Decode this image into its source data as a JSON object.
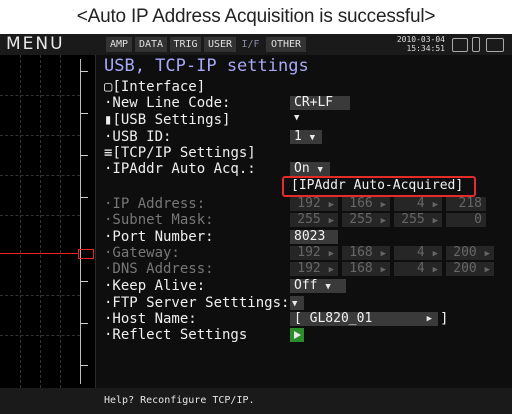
{
  "caption": "<Auto IP Address Acquisition is successful>",
  "topbar": {
    "menu": "MENU",
    "tabs": [
      {
        "label": "AMP"
      },
      {
        "label": "DATA"
      },
      {
        "label": "TRIG"
      },
      {
        "label": "USER"
      },
      {
        "label": "I/F"
      },
      {
        "label": "OTHER"
      }
    ],
    "date": "2010-03-04",
    "time": "15:34:51"
  },
  "settings": {
    "title": "USB, TCP-IP settings",
    "interface_header": "[Interface]",
    "new_line_code": {
      "label": "·New Line Code:",
      "value": "CR+LF"
    },
    "usb_header": "[USB Settings]",
    "usb_id": {
      "label": "·USB ID:",
      "value": "1"
    },
    "tcpip_header": "[TCP/IP Settings]",
    "ipaddr_auto": {
      "label": "·IPAddr Auto Acq.:",
      "value": "On"
    },
    "auto_acquired_note": "[IPAddr Auto-Acquired]",
    "ip_address": {
      "label": "·IP Address:",
      "octets": [
        "192",
        "166",
        "4",
        "218"
      ]
    },
    "subnet_mask": {
      "label": "·Subnet Mask:",
      "octets": [
        "255",
        "255",
        "255",
        "0"
      ]
    },
    "port_number": {
      "label": "·Port Number:",
      "value": "8023"
    },
    "gateway": {
      "label": "·Gateway:",
      "octets": [
        "192",
        "168",
        "4",
        "200"
      ]
    },
    "dns_address": {
      "label": "·DNS Address:",
      "octets": [
        "192",
        "168",
        "4",
        "200"
      ]
    },
    "keep_alive": {
      "label": "·Keep Alive:",
      "value": "Off"
    },
    "ftp_server": {
      "label": "·FTP Server Setttings:"
    },
    "host_name": {
      "label": "·Host Name:",
      "value": "[ GL820_01",
      "close": "]"
    },
    "reflect": {
      "label": "·Reflect Settings"
    }
  },
  "status": "Help? Reconfigure TCP/IP.",
  "colors": {
    "title": "#a8a8f8",
    "highlight": "#e52a2a",
    "trace": "#ee2222",
    "execute_button": "#2a8c2a"
  },
  "icons": [
    "window-icon",
    "usb-icon",
    "network-icon",
    "arrow-right-icon",
    "dropdown-arrow-icon",
    "play-icon",
    "battery-icon",
    "memory-card-icon"
  ]
}
